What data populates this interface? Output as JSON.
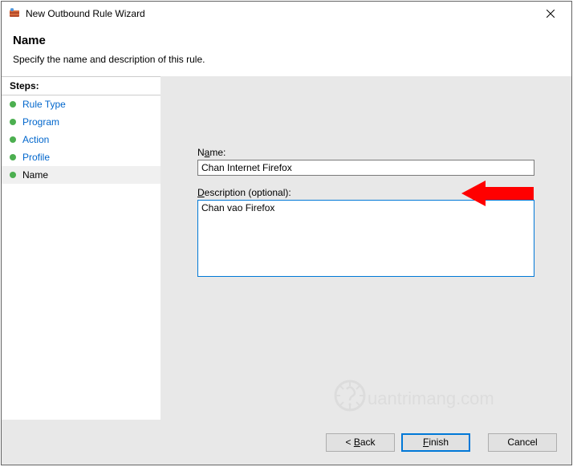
{
  "window": {
    "title": "New Outbound Rule Wizard"
  },
  "header": {
    "title": "Name",
    "subtitle": "Specify the name and description of this rule."
  },
  "sidebar": {
    "steps_label": "Steps:",
    "items": [
      {
        "label": "Rule Type",
        "state": "done"
      },
      {
        "label": "Program",
        "state": "done"
      },
      {
        "label": "Action",
        "state": "done"
      },
      {
        "label": "Profile",
        "state": "done"
      },
      {
        "label": "Name",
        "state": "current"
      }
    ]
  },
  "main": {
    "name_label_pre": "N",
    "name_label_hot": "a",
    "name_label_post": "me:",
    "name_value": "Chan Internet Firefox",
    "desc_label_hot": "D",
    "desc_label_post": "escription (optional):",
    "desc_value": "Chan vao Firefox"
  },
  "footer": {
    "back_pre": "< ",
    "back_hot": "B",
    "back_post": "ack",
    "finish_hot": "F",
    "finish_post": "inish",
    "cancel": "Cancel"
  },
  "watermark": {
    "text": "uantrimang.com"
  }
}
